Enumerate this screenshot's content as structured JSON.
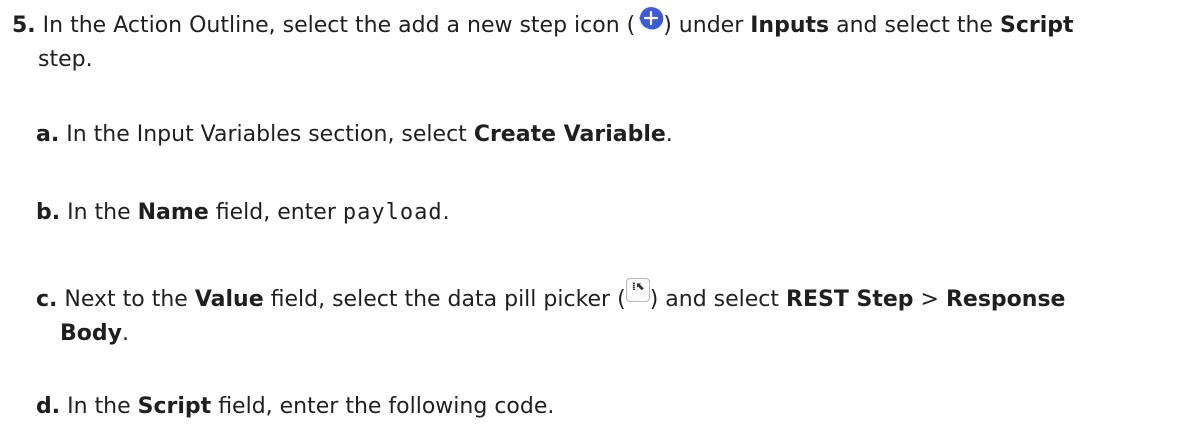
{
  "step5": {
    "number": "5.",
    "text1": "In the Action Outline, select the add a new step icon (",
    "text2": ") under",
    "inputs": "Inputs",
    "text3": "and select the",
    "script": "Script",
    "text4": "step."
  },
  "sub_a": {
    "letter": "a.",
    "text1": "In the Input Variables section, select",
    "create_variable": "Create Variable",
    "text2": "."
  },
  "sub_b": {
    "letter": "b.",
    "text1": "In the",
    "name": "Name",
    "text2": "field, enter",
    "code": "payload",
    "text3": "."
  },
  "sub_c": {
    "letter": "c.",
    "text1": "Next to the",
    "value": "Value",
    "text2": "field, select the data pill picker (",
    "text3": ") and select",
    "rest_step": "REST Step",
    "sep": ">",
    "response": "Response",
    "body": "Body",
    "text4": "."
  },
  "sub_d": {
    "letter": "d.",
    "text1": "In the",
    "script": "Script",
    "text2": "field, enter the following code."
  },
  "colors": {
    "add_icon": "#3d5ad8",
    "text": "#1f1f1f"
  },
  "icons": {
    "add": "add-step-icon",
    "pill": "data-pill-picker-icon"
  }
}
